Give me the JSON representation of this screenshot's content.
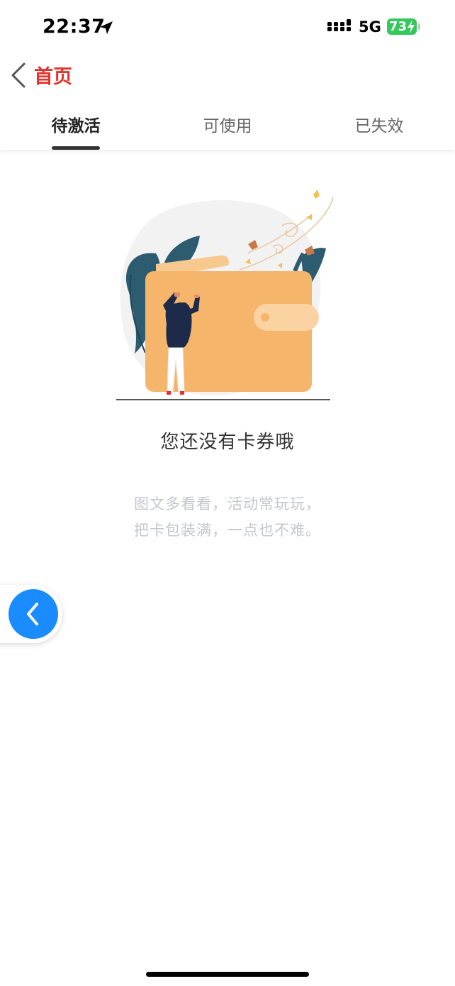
{
  "status_bar": {
    "time": "22:37",
    "network": "5G",
    "battery": "73"
  },
  "nav": {
    "title": "首页"
  },
  "tabs": [
    {
      "label": "待激活",
      "active": true
    },
    {
      "label": "可使用",
      "active": false
    },
    {
      "label": "已失效",
      "active": false
    }
  ],
  "empty_state": {
    "title": "您还没有卡券哦",
    "desc_line1": "图文多看看，活动常玩玩，",
    "desc_line2": "把卡包装满，一点也不难。"
  },
  "colors": {
    "accent": "#e8312b",
    "float_button": "#1a8cff",
    "wallet": "#f5b56b",
    "leaf": "#2d5b70"
  },
  "icons": {
    "location": "location-arrow-icon",
    "back": "chevron-left-icon",
    "float_back": "chevron-left-icon"
  }
}
